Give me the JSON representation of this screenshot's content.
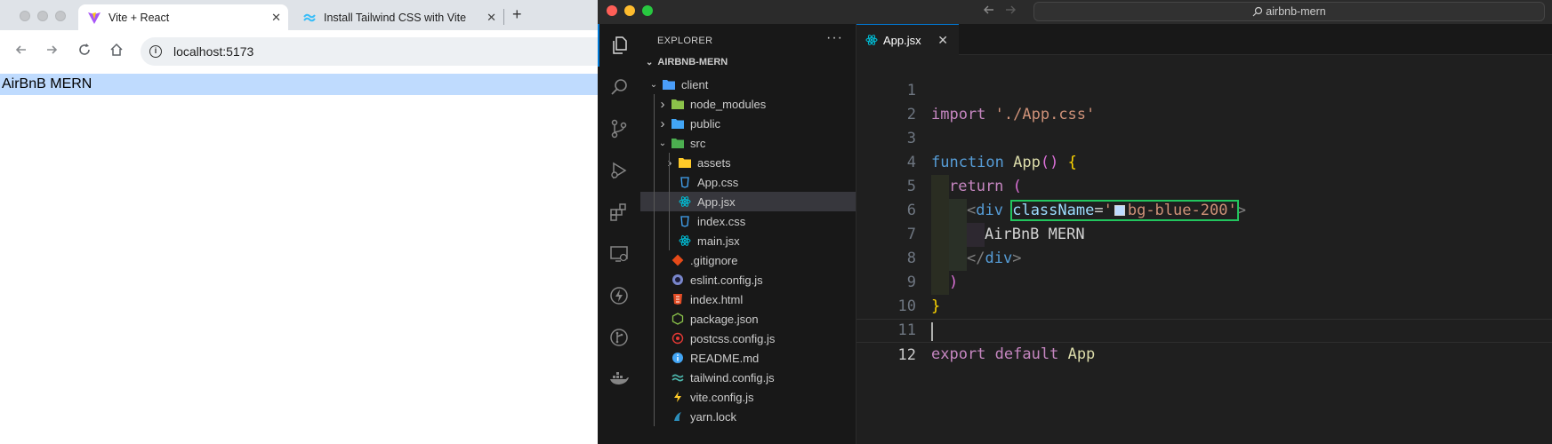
{
  "browser": {
    "tabs": [
      {
        "title": "Vite + React",
        "icon": "vite-icon",
        "active": true
      },
      {
        "title": "Install Tailwind CSS with Vite",
        "icon": "tailwind-icon",
        "active": false
      }
    ],
    "new_tab_label": "+",
    "close_label": "✕",
    "url": "localhost:5173",
    "page_text": "AirBnB MERN",
    "page_bg": "#bfdbfe"
  },
  "vscode": {
    "search_label": "airbnb-mern",
    "explorer_title": "EXPLORER",
    "more_label": "···",
    "project": "AIRBNB-MERN",
    "tree": [
      {
        "label": "client",
        "depth": 1,
        "chev": "down",
        "icon": "folder-client-icon",
        "color": "#4a9df8"
      },
      {
        "label": "node_modules",
        "depth": 2,
        "chev": "right",
        "icon": "folder-node-icon",
        "color": "#8bc34a"
      },
      {
        "label": "public",
        "depth": 2,
        "chev": "right",
        "icon": "folder-public-icon",
        "color": "#42a5f5"
      },
      {
        "label": "src",
        "depth": 2,
        "chev": "down",
        "icon": "folder-src-icon",
        "color": "#4caf50"
      },
      {
        "label": "assets",
        "depth": 3,
        "chev": "right",
        "icon": "folder-assets-icon",
        "color": "#ffca28"
      },
      {
        "label": "App.css",
        "depth": 3,
        "chev": "",
        "icon": "css-icon",
        "color": "#42a5f5"
      },
      {
        "label": "App.jsx",
        "depth": 3,
        "chev": "",
        "icon": "react-icon",
        "color": "#00bcd4",
        "selected": true
      },
      {
        "label": "index.css",
        "depth": 3,
        "chev": "",
        "icon": "css-icon",
        "color": "#42a5f5"
      },
      {
        "label": "main.jsx",
        "depth": 3,
        "chev": "",
        "icon": "react-icon",
        "color": "#00bcd4"
      },
      {
        "label": ".gitignore",
        "depth": 2,
        "chev": "",
        "icon": "git-icon",
        "color": "#e64a19"
      },
      {
        "label": "eslint.config.js",
        "depth": 2,
        "chev": "",
        "icon": "eslint-icon",
        "color": "#7986cb"
      },
      {
        "label": "index.html",
        "depth": 2,
        "chev": "",
        "icon": "html-icon",
        "color": "#e44d26"
      },
      {
        "label": "package.json",
        "depth": 2,
        "chev": "",
        "icon": "nodejs-icon",
        "color": "#8bc34a"
      },
      {
        "label": "postcss.config.js",
        "depth": 2,
        "chev": "",
        "icon": "postcss-icon",
        "color": "#e53935"
      },
      {
        "label": "README.md",
        "depth": 2,
        "chev": "",
        "icon": "info-icon",
        "color": "#42a5f5"
      },
      {
        "label": "tailwind.config.js",
        "depth": 2,
        "chev": "",
        "icon": "tailwind-icon",
        "color": "#4db6ac"
      },
      {
        "label": "vite.config.js",
        "depth": 2,
        "chev": "",
        "icon": "lightning-icon",
        "color": "#ffca28"
      },
      {
        "label": "yarn.lock",
        "depth": 2,
        "chev": "",
        "icon": "yarn-icon",
        "color": "#2c8ebb"
      }
    ],
    "editor_tab": "App.jsx",
    "close_label": "✕",
    "code": {
      "l1_kw": "import",
      "l1_str": "'./App.css'",
      "l3_kw": "function",
      "l3_fn": "App",
      "l3_paren": "()",
      "l3_brace": "{",
      "l4_kw": "return",
      "l4_paren": "(",
      "l5_open": "<",
      "l5_tag": "div",
      "l5_attr": "className",
      "l5_eq": "=",
      "l5_q1": "'",
      "l5_val": "bg-blue-200",
      "l5_q2": "'",
      "l5_close": ">",
      "l6_text": "AirBnB MERN",
      "l7_open": "</",
      "l7_tag": "div",
      "l7_close": ">",
      "l8_paren": ")",
      "l9_brace": "}",
      "l11_kw1": "export",
      "l11_kw2": "default",
      "l11_id": "App"
    },
    "line_numbers": [
      "1",
      "2",
      "3",
      "4",
      "5",
      "6",
      "7",
      "8",
      "9",
      "10",
      "11",
      "12"
    ]
  }
}
